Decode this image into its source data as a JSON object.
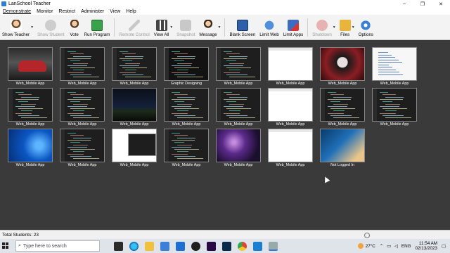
{
  "window": {
    "title": "LanSchool Teacher",
    "controls": [
      "–",
      "❐",
      "✕"
    ]
  },
  "menu": [
    "Demonstrate",
    "Monitor",
    "Restrict",
    "Administer",
    "View",
    "Help"
  ],
  "toolbar": {
    "show_teacher": "Show Teacher",
    "show_student": "Show Student",
    "vote": "Vote",
    "run_program": "Run Program",
    "remote_control": "Remote Control",
    "view_all": "View All",
    "snapshot": "Snapshot",
    "message": "Message",
    "blank_screen": "Blank Screen",
    "limit_web": "Limit Web",
    "limit_apps": "Limit Apps",
    "shutdown": "Shutdown",
    "files": "Files",
    "options": "Options"
  },
  "students": [
    {
      "label": "Web_Mobile App",
      "screen": "car"
    },
    {
      "label": "Web_Mobile App",
      "screen": "code"
    },
    {
      "label": "Web_Mobile App",
      "screen": "code"
    },
    {
      "label": "Graphic Designing",
      "screen": "code-dark"
    },
    {
      "label": "Web_Mobile App",
      "screen": "code"
    },
    {
      "label": "Web_Mobile App",
      "screen": "white"
    },
    {
      "label": "Web_Mobile App",
      "screen": "mask"
    },
    {
      "label": "Web_Mobile App",
      "screen": "white-code"
    },
    {
      "label": "Web_Mobile App",
      "screen": "code"
    },
    {
      "label": "Web_Mobile App",
      "screen": "code"
    },
    {
      "label": "Web_Mobile App",
      "screen": "night"
    },
    {
      "label": "Web_Mobile App",
      "screen": "code"
    },
    {
      "label": "Web_Mobile App",
      "screen": "code"
    },
    {
      "label": "Web_Mobile App",
      "screen": "white"
    },
    {
      "label": "Web_Mobile App",
      "screen": "code"
    },
    {
      "label": "Web_Mobile App",
      "screen": "code"
    },
    {
      "label": "Web_Mobile App",
      "screen": "win-blue"
    },
    {
      "label": "Web_Mobile App",
      "screen": "code"
    },
    {
      "label": "Web_Mobile App",
      "screen": "white-blue"
    },
    {
      "label": "Web_Mobile App",
      "screen": "code"
    },
    {
      "label": "Web_Mobile App",
      "screen": "space"
    },
    {
      "label": "Web_Mobile App",
      "screen": "white"
    },
    {
      "label": "Not Logged In",
      "screen": "lock"
    }
  ],
  "status": {
    "total_students": "Total Students: 23"
  },
  "taskbar": {
    "search_placeholder": "Type here to search",
    "weather": "27°C",
    "language": "ENG",
    "time": "11:54 AM",
    "date": "02/13/2023"
  }
}
